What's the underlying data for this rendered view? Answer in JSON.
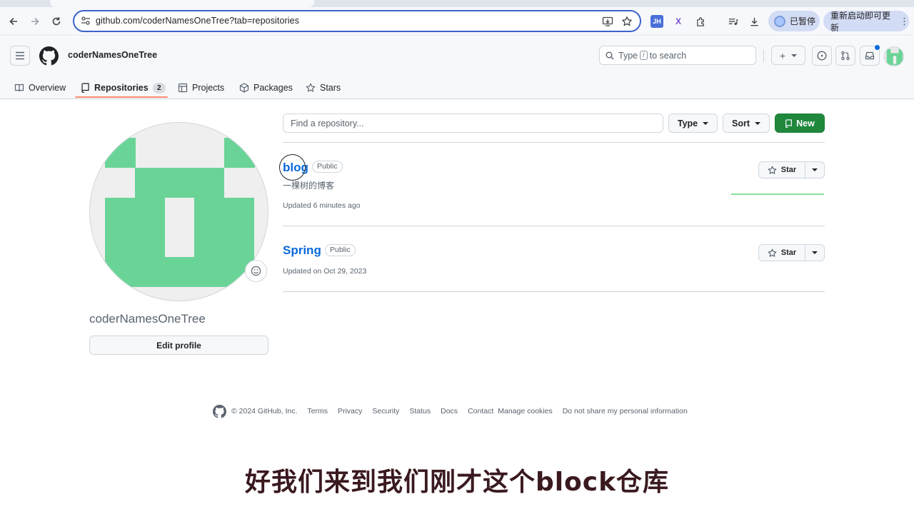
{
  "browser": {
    "url": "github.com/coderNamesOneTree?tab=repositories",
    "profile_status": "已暂停",
    "update_label": "重新启动即可更新",
    "extensions": [
      {
        "name": "jh-extension-icon",
        "label": "JH",
        "color": "#4a6fd8"
      },
      {
        "name": "x-extension-icon",
        "label": "X",
        "color": "#7a4fd0"
      }
    ]
  },
  "header": {
    "username": "coderNamesOneTree",
    "search_prefix": "Type",
    "search_key": "/",
    "search_suffix": "to search",
    "plus_label": "+"
  },
  "tabs": [
    {
      "label": "Overview",
      "icon": "book-icon"
    },
    {
      "label": "Repositories",
      "icon": "repo-icon",
      "count": "2"
    },
    {
      "label": "Projects",
      "icon": "table-icon"
    },
    {
      "label": "Packages",
      "icon": "package-icon"
    },
    {
      "label": "Stars",
      "icon": "star-icon"
    }
  ],
  "profile": {
    "name": "coderNamesOneTree",
    "edit_label": "Edit profile"
  },
  "repo_controls": {
    "find_placeholder": "Find a repository...",
    "type_label": "Type",
    "sort_label": "Sort",
    "new_label": "New"
  },
  "repos": [
    {
      "name": "blog",
      "visibility": "Public",
      "description": "一棵树的博客",
      "updated": "Updated 6 minutes ago",
      "star_label": "Star"
    },
    {
      "name": "Spring",
      "visibility": "Public",
      "description": "",
      "updated": "Updated on Oct 29, 2023",
      "star_label": "Star"
    }
  ],
  "footer": {
    "copyright": "© 2024 GitHub, Inc.",
    "links": [
      "Terms",
      "Privacy",
      "Security",
      "Status",
      "Docs",
      "Contact",
      "Manage cookies",
      "Do not share my personal information"
    ]
  },
  "subtitle": "好我们来到我们刚才这个block仓库",
  "colors": {
    "accent": "#0969da",
    "new_button": "#1f883d",
    "tab_underline": "#fd8c73",
    "identicon": "#6ad497"
  }
}
